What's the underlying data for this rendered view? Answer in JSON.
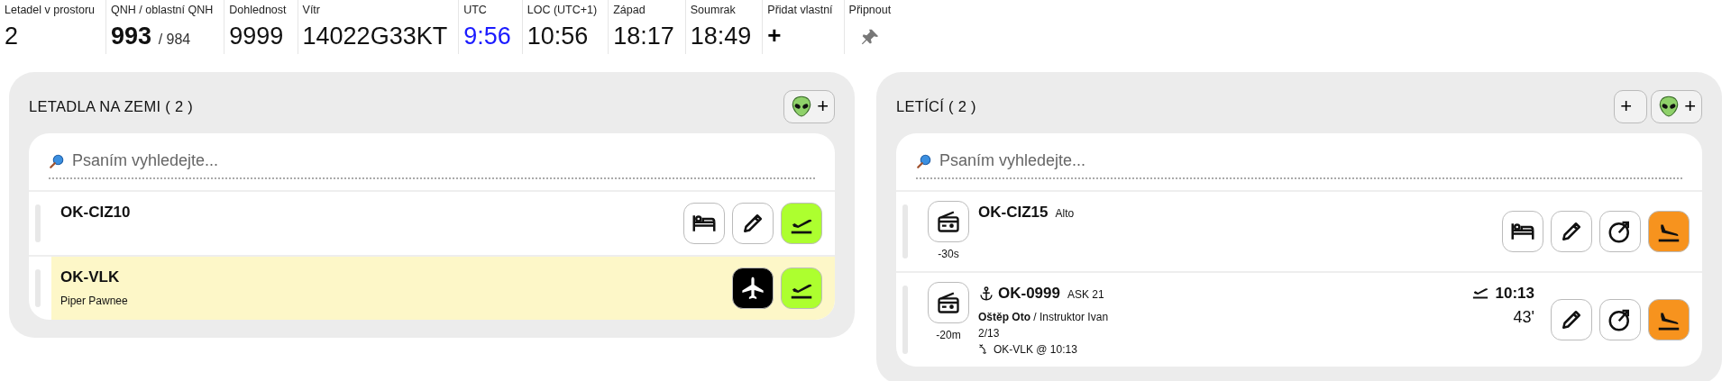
{
  "stats": [
    {
      "label": "Letadel v prostoru",
      "value": "2",
      "kind": "plain"
    },
    {
      "label": "QNH / oblastní QNH",
      "value": "993",
      "secondary": "/ 984",
      "kind": "qnh"
    },
    {
      "label": "Dohlednost",
      "value": "9999",
      "kind": "plain"
    },
    {
      "label": "Vítr",
      "value": "14022G33KT",
      "kind": "plain"
    },
    {
      "label": "UTC",
      "value": "9:56",
      "kind": "utc"
    },
    {
      "label": "LOC (UTC+1)",
      "value": "10:56",
      "kind": "plain"
    },
    {
      "label": "Západ",
      "value": "18:17",
      "kind": "plain"
    },
    {
      "label": "Soumrak",
      "value": "18:49",
      "kind": "plain"
    },
    {
      "label": "Přidat vlastní",
      "value": "+",
      "kind": "add"
    },
    {
      "label": "Připnout",
      "kind": "pin"
    }
  ],
  "panels": [
    {
      "title": "LETADLA NA ZEMI ( 2 )",
      "header_buttons": [
        {
          "kind": "alien",
          "label": "+"
        }
      ],
      "search": {
        "placeholder": "Psaním vyhledejte..."
      },
      "rows": [
        {
          "registration": "OK-CIZ10",
          "highlighted": false,
          "actions": [
            {
              "kind": "bed"
            },
            {
              "kind": "edit"
            },
            {
              "kind": "takeoff"
            }
          ]
        },
        {
          "registration": "OK-VLK",
          "subtitle": "Piper Pawnee",
          "highlighted": true,
          "actions": [
            {
              "kind": "plane"
            },
            {
              "kind": "takeoff"
            }
          ]
        }
      ]
    },
    {
      "title": "LETÍCÍ ( 2 )",
      "header_buttons": [
        {
          "kind": "plain",
          "label": "+"
        },
        {
          "kind": "alien",
          "label": "+"
        }
      ],
      "search": {
        "placeholder": "Psaním vyhledejte..."
      },
      "rows": [
        {
          "radio": "-30s",
          "registration": "OK-CIZ15",
          "type": "Alto",
          "actions": [
            {
              "kind": "bed"
            },
            {
              "kind": "edit"
            },
            {
              "kind": "gauge"
            },
            {
              "kind": "landing"
            }
          ]
        },
        {
          "radio": "-20m",
          "winch": true,
          "registration": "OK-0999",
          "type": "ASK 21",
          "crew": "**Oštěp Oto** / Instruktor Ivan",
          "info": "2/13",
          "tow": "OK-VLK @ 10:13",
          "takeoff_time": "10:13",
          "duration": "43'",
          "actions": [
            {
              "kind": "edit"
            },
            {
              "kind": "gauge"
            },
            {
              "kind": "landing"
            }
          ]
        }
      ]
    }
  ]
}
